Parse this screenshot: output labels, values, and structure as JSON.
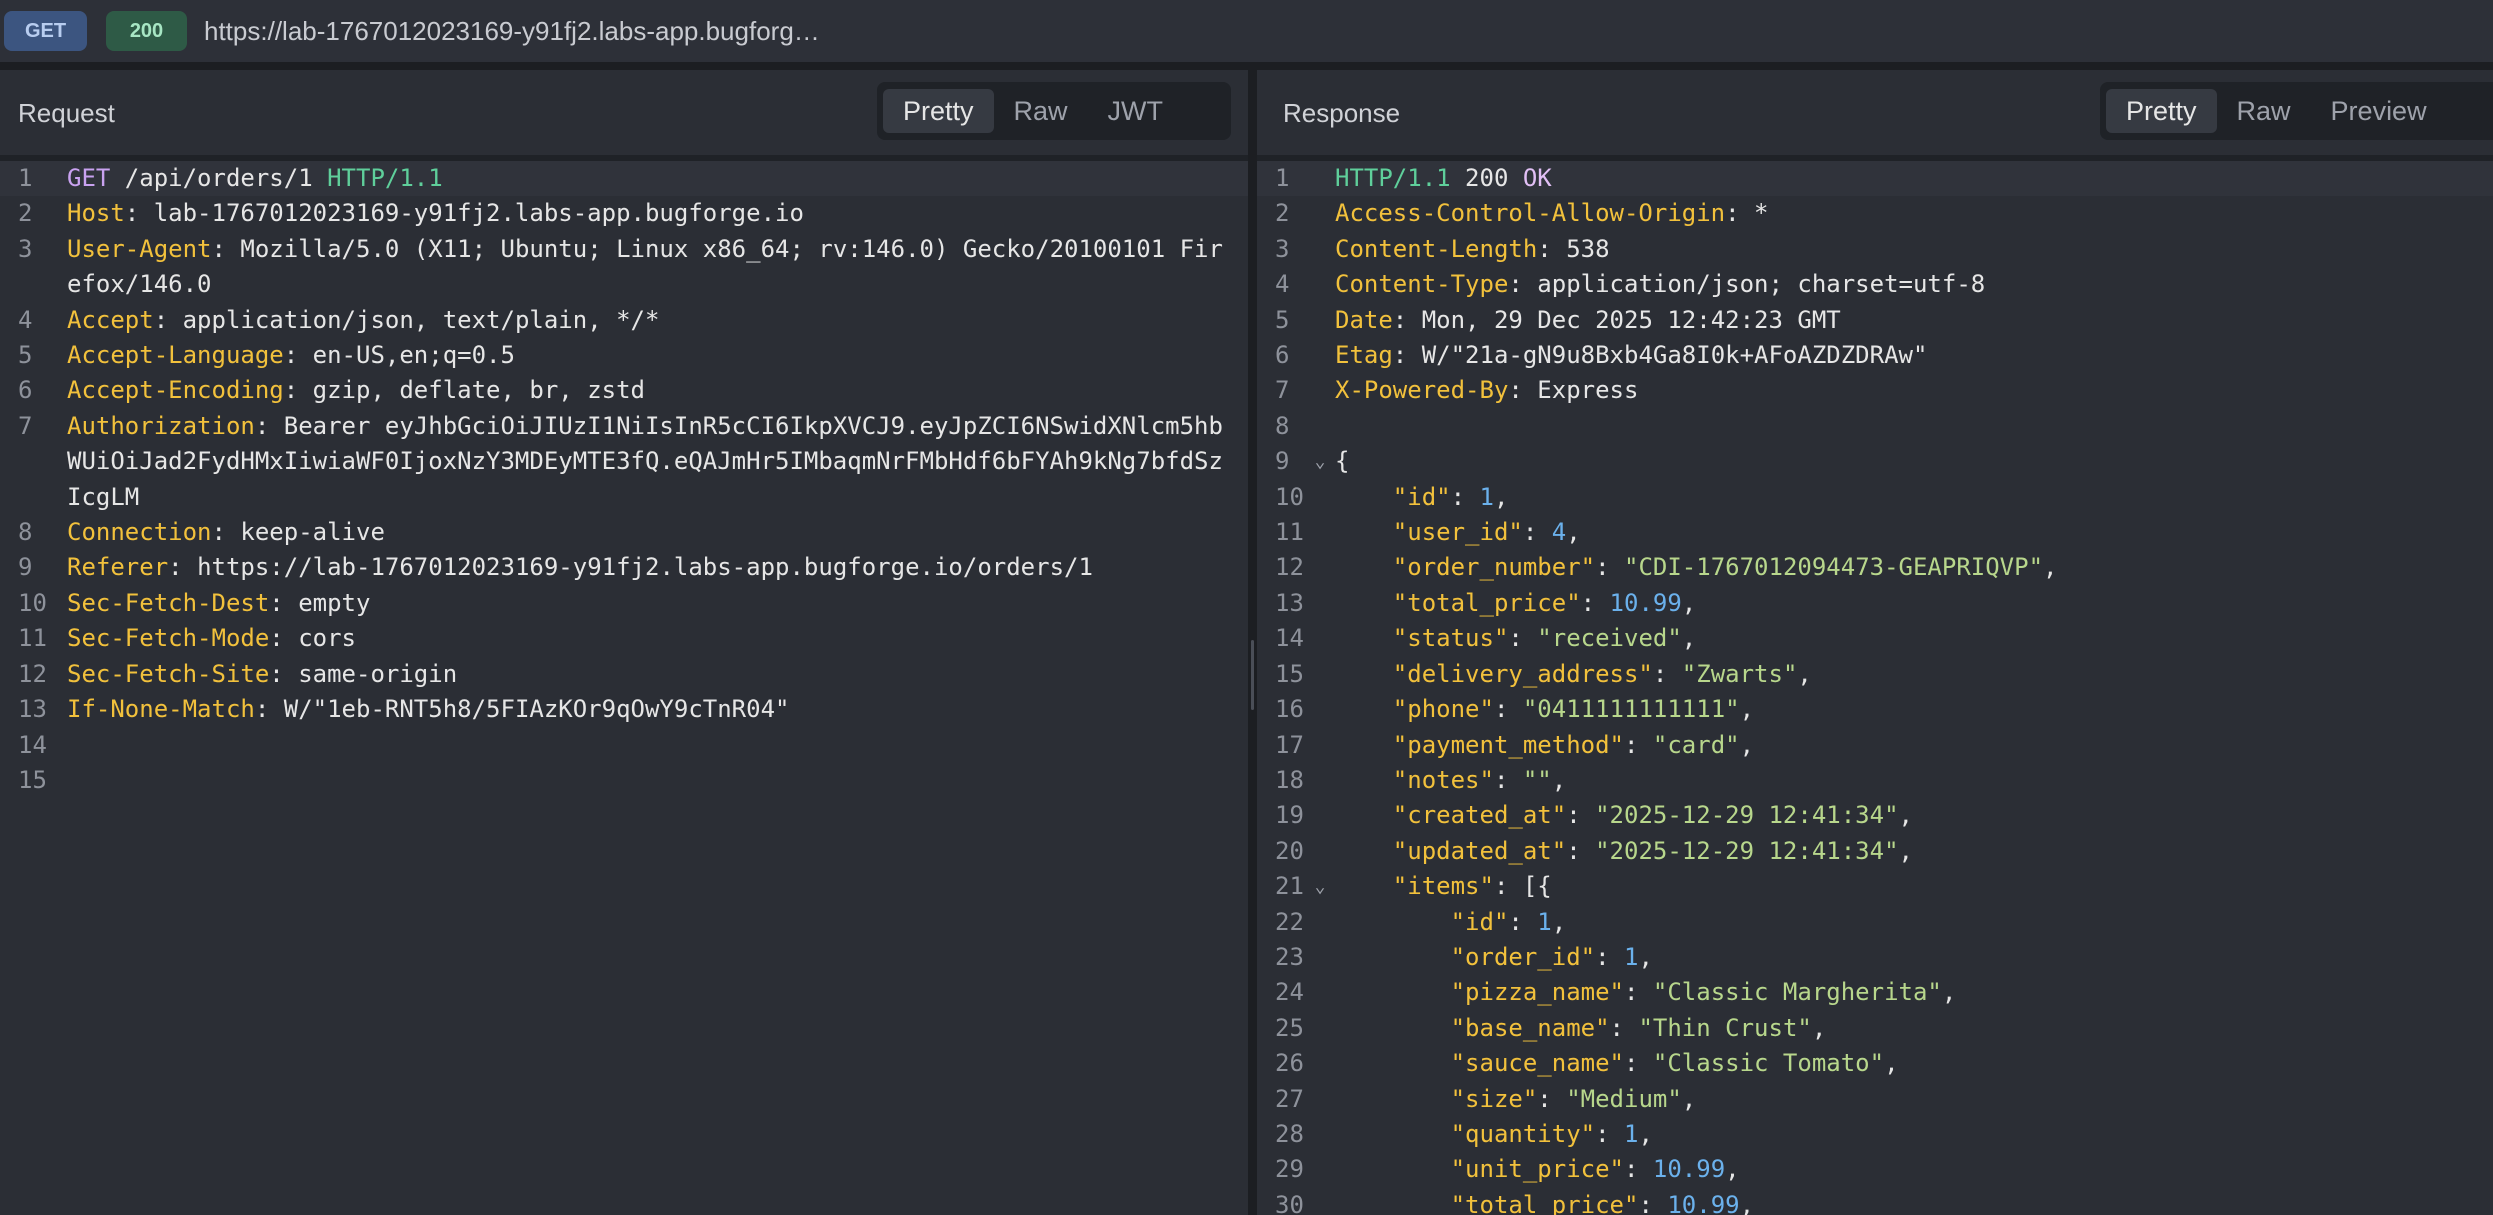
{
  "topbar": {
    "method": "GET",
    "status_code": "200",
    "url": "https://lab-1767012023169-y91fj2.labs-app.bugforg…"
  },
  "request": {
    "title": "Request",
    "tabs": [
      {
        "label": "Pretty",
        "active": true
      },
      {
        "label": "Raw",
        "active": false
      },
      {
        "label": "JWT",
        "active": false
      }
    ],
    "request_line": {
      "method": "GET",
      "path": " /api/orders/1 ",
      "protocol": "HTTP/1.1"
    },
    "headers": [
      {
        "line": "2",
        "name": "Host",
        "value": "lab-1767012023169-y91fj2.labs-app.bugforge.io"
      },
      {
        "line": "3",
        "name": "User-Agent",
        "value": "Mozilla/5.0 (X11; Ubuntu; Linux x86_64; rv:146.0) Gecko/20100101 Firefox/146.0"
      },
      {
        "line": "4",
        "name": "Accept",
        "value": "application/json, text/plain, */*"
      },
      {
        "line": "5",
        "name": "Accept-Language",
        "value": "en-US,en;q=0.5"
      },
      {
        "line": "6",
        "name": "Accept-Encoding",
        "value": "gzip, deflate, br, zstd"
      },
      {
        "line": "7",
        "name": "Authorization",
        "value": "Bearer eyJhbGciOiJIUzI1NiIsInR5cCI6IkpXVCJ9.eyJpZCI6NSwidXNlcm5hbWUiOiJad2FydHMxIiwiaWF0IjoxNzY3MDEyMTE3fQ.eQAJmHr5IMbaqmNrFMbHdf6bFYAh9kNg7bfdSzIcgLM"
      },
      {
        "line": "8",
        "name": "Connection",
        "value": "keep-alive"
      },
      {
        "line": "9",
        "name": "Referer",
        "value": "https://lab-1767012023169-y91fj2.labs-app.bugforge.io/orders/1"
      },
      {
        "line": "10",
        "name": "Sec-Fetch-Dest",
        "value": "empty"
      },
      {
        "line": "11",
        "name": "Sec-Fetch-Mode",
        "value": "cors"
      },
      {
        "line": "12",
        "name": "Sec-Fetch-Site",
        "value": "same-origin"
      },
      {
        "line": "13",
        "name": "If-None-Match",
        "value": "W/\"1eb-RNT5h8/5FIAzKOr9qOwY9cTnR04\""
      }
    ],
    "trailing_lines": [
      "14",
      "15"
    ]
  },
  "response": {
    "title": "Response",
    "tabs": [
      {
        "label": "Pretty",
        "active": true
      },
      {
        "label": "Raw",
        "active": false
      },
      {
        "label": "Preview",
        "active": false
      }
    ],
    "status_line": {
      "protocol": "HTTP/1.1",
      "code": " 200 ",
      "text": "OK"
    },
    "headers": [
      {
        "line": "2",
        "name": "Access-Control-Allow-Origin",
        "value": "*"
      },
      {
        "line": "3",
        "name": "Content-Length",
        "value": "538"
      },
      {
        "line": "4",
        "name": "Content-Type",
        "value": "application/json; charset=utf-8"
      },
      {
        "line": "5",
        "name": "Date",
        "value": "Mon, 29 Dec 2025 12:42:23 GMT"
      },
      {
        "line": "6",
        "name": "Etag",
        "value": "W/\"21a-gN9u8Bxb4Ga8I0k+AFoAZDZDRAw\""
      },
      {
        "line": "7",
        "name": "X-Powered-By",
        "value": "Express"
      }
    ],
    "blank_line": "8",
    "json_open": {
      "line": "9",
      "text": "{"
    },
    "json_fields": [
      {
        "line": "10",
        "key": "\"id\"",
        "value": "1",
        "type": "num"
      },
      {
        "line": "11",
        "key": "\"user_id\"",
        "value": "4",
        "type": "num"
      },
      {
        "line": "12",
        "key": "\"order_number\"",
        "value": "\"CDI-1767012094473-GEAPRIQVP\"",
        "type": "str"
      },
      {
        "line": "13",
        "key": "\"total_price\"",
        "value": "10.99",
        "type": "num"
      },
      {
        "line": "14",
        "key": "\"status\"",
        "value": "\"received\"",
        "type": "str"
      },
      {
        "line": "15",
        "key": "\"delivery_address\"",
        "value": "\"Zwarts\"",
        "type": "str"
      },
      {
        "line": "16",
        "key": "\"phone\"",
        "value": "\"0411111111111\"",
        "type": "str"
      },
      {
        "line": "17",
        "key": "\"payment_method\"",
        "value": "\"card\"",
        "type": "str"
      },
      {
        "line": "18",
        "key": "\"notes\"",
        "value": "\"\"",
        "type": "str"
      },
      {
        "line": "19",
        "key": "\"created_at\"",
        "value": "\"2025-12-29 12:41:34\"",
        "type": "str"
      },
      {
        "line": "20",
        "key": "\"updated_at\"",
        "value": "\"2025-12-29 12:41:34\"",
        "type": "str"
      }
    ],
    "items_open": {
      "line": "21",
      "key": "\"items\"",
      "text": "[{"
    },
    "item_fields": [
      {
        "line": "22",
        "key": "\"id\"",
        "value": "1",
        "type": "num"
      },
      {
        "line": "23",
        "key": "\"order_id\"",
        "value": "1",
        "type": "num"
      },
      {
        "line": "24",
        "key": "\"pizza_name\"",
        "value": "\"Classic Margherita\"",
        "type": "str"
      },
      {
        "line": "25",
        "key": "\"base_name\"",
        "value": "\"Thin Crust\"",
        "type": "str"
      },
      {
        "line": "26",
        "key": "\"sauce_name\"",
        "value": "\"Classic Tomato\"",
        "type": "str"
      },
      {
        "line": "27",
        "key": "\"size\"",
        "value": "\"Medium\"",
        "type": "str"
      },
      {
        "line": "28",
        "key": "\"quantity\"",
        "value": "1",
        "type": "num"
      },
      {
        "line": "29",
        "key": "\"unit_price\"",
        "value": "10.99",
        "type": "num"
      },
      {
        "line": "30",
        "key": "\"total_price\"",
        "value": "10.99",
        "type": "num"
      }
    ]
  }
}
